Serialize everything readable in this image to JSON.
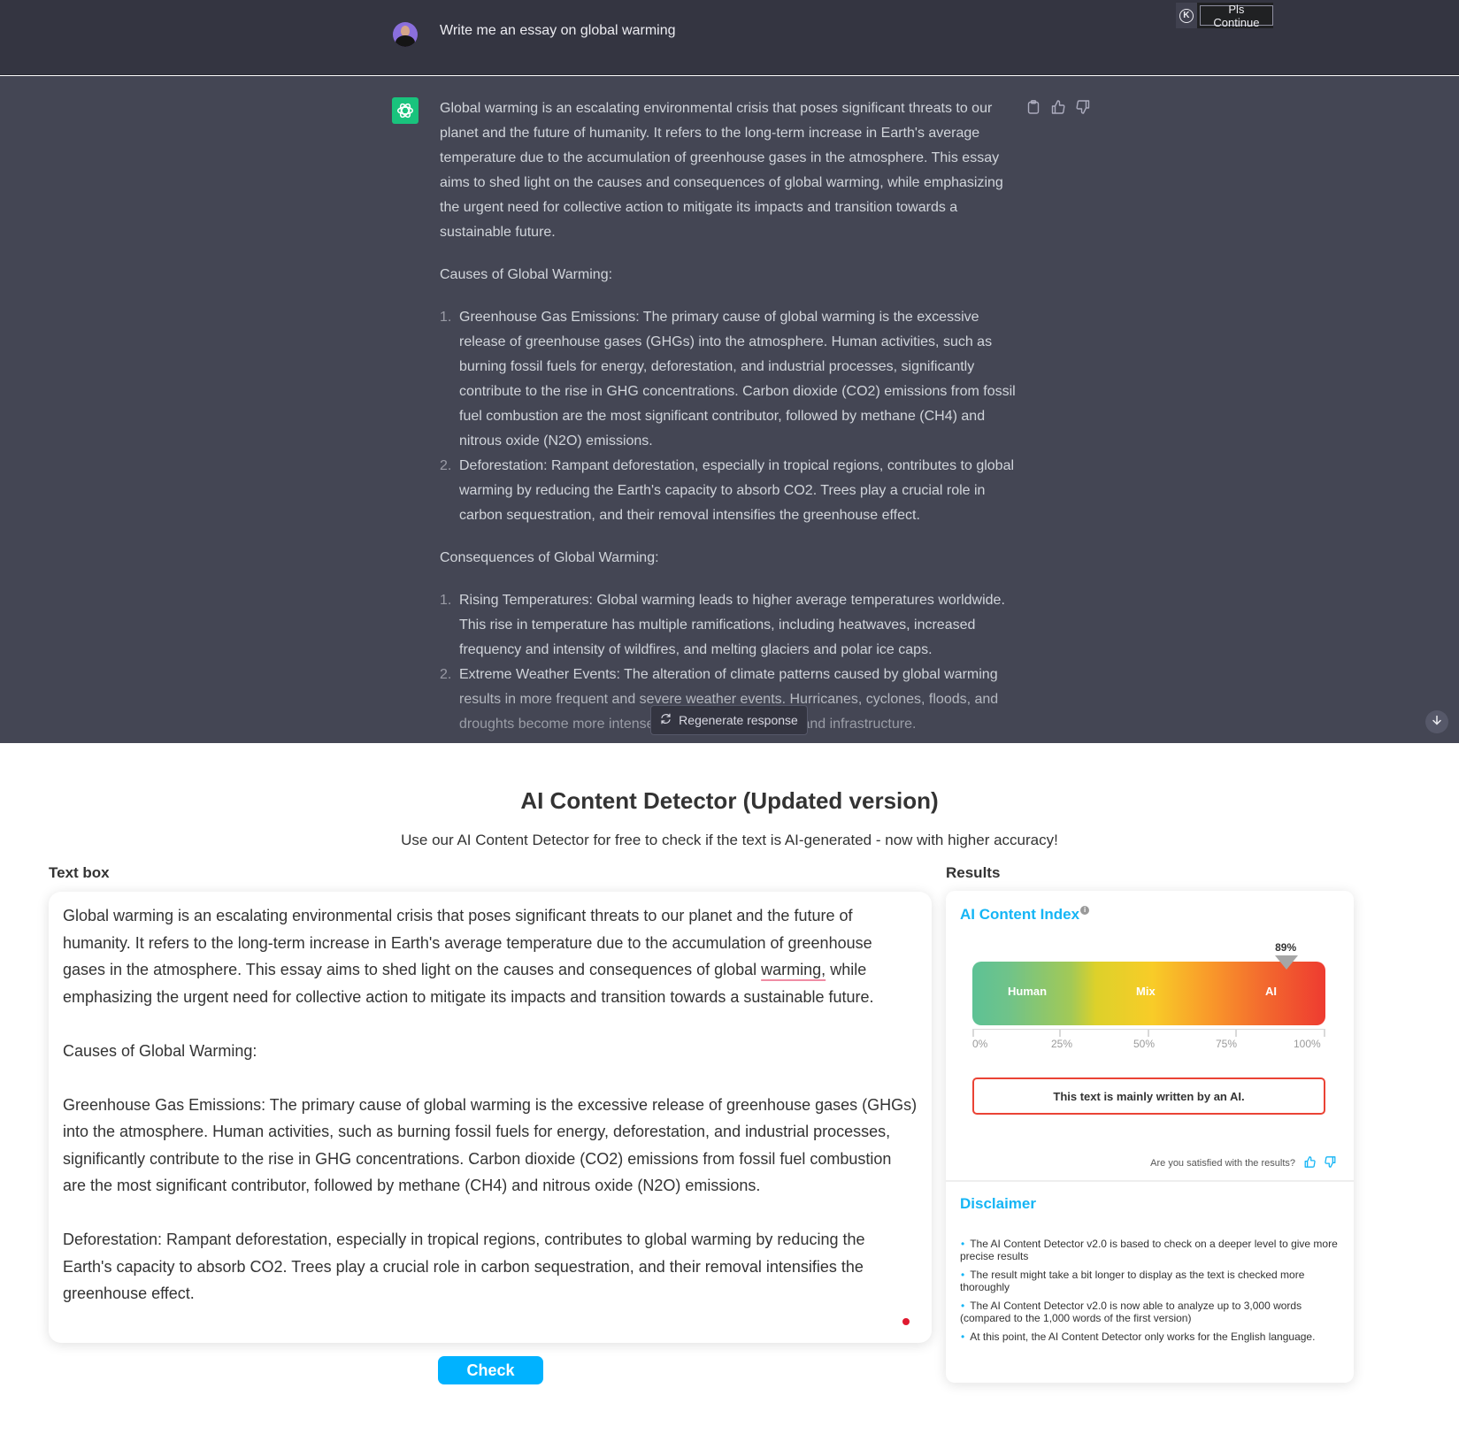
{
  "chat": {
    "prompt": "Write me an essay on global warming",
    "extension_button": "Pls Continue",
    "extension_icon": "K",
    "response": {
      "intro": "Global warming is an escalating environmental crisis that poses significant threats to our planet and the future of humanity. It refers to the long-term increase in Earth's average temperature due to the accumulation of greenhouse gases in the atmosphere. This essay aims to shed light on the causes and consequences of global warming, while emphasizing the urgent need for collective action to mitigate its impacts and transition towards a sustainable future.",
      "causes_heading": "Causes of Global Warming:",
      "causes": [
        {
          "num": "1.",
          "text": "Greenhouse Gas Emissions: The primary cause of global warming is the excessive release of greenhouse gases (GHGs) into the atmosphere. Human activities, such as burning fossil fuels for energy, deforestation, and industrial processes, significantly contribute to the rise in GHG concentrations. Carbon dioxide (CO2) emissions from fossil fuel combustion are the most significant contributor, followed by methane (CH4) and nitrous oxide (N2O) emissions."
        },
        {
          "num": "2.",
          "text": "Deforestation: Rampant deforestation, especially in tropical regions, contributes to global warming by reducing the Earth's capacity to absorb CO2. Trees play a crucial role in carbon sequestration, and their removal intensifies the greenhouse effect."
        }
      ],
      "consequences_heading": "Consequences of Global Warming:",
      "consequences": [
        {
          "num": "1.",
          "text": "Rising Temperatures: Global warming leads to higher average temperatures worldwide. This rise in temperature has multiple ramifications, including heatwaves, increased frequency and intensity of wildfires, and melting glaciers and polar ice caps."
        },
        {
          "num": "2.",
          "text": "Extreme Weather Events: The alteration of climate patterns caused by global warming results in more frequent and severe weather events. Hurricanes, cyclones, floods, and droughts become more intense, affecting ecosystems, and infrastructure."
        }
      ]
    },
    "actions": [
      "copy-icon",
      "thumbs-up-icon",
      "thumbs-down-icon"
    ],
    "regenerate_label": "Regenerate response"
  },
  "detector": {
    "title": "AI Content Detector (Updated version)",
    "subtitle": "Use our AI Content Detector for free to check if the text is AI-generated - now with higher accuracy!",
    "textbox_label": "Text box",
    "textbox": {
      "para1_before": "Global warming is an escalating environmental crisis that poses significant threats to our planet and the future of humanity. It refers to the long-term increase in Earth's average temperature due to the accumulation of greenhouse gases in the atmosphere. This essay aims to shed light on the causes and consequences of global ",
      "para1_flagged": "warming,",
      "para1_after": " while emphasizing the urgent need for collective action to mitigate its impacts and transition towards a sustainable future.",
      "rest": "\n\nCauses of Global Warming:\n\nGreenhouse Gas Emissions: The primary cause of global warming is the excessive release of greenhouse gases (GHGs) into the atmosphere. Human activities, such as burning fossil fuels for energy, deforestation, and industrial processes, significantly contribute to the rise in GHG concentrations. Carbon dioxide (CO2) emissions from fossil fuel combustion are the most significant contributor, followed by methane (CH4) and nitrous oxide (N2O) emissions.\n\nDeforestation: Rampant deforestation, especially in tropical regions, contributes to global warming by reducing the Earth's capacity to absorb CO2. Trees play a crucial role in carbon sequestration, and their removal intensifies the greenhouse effect."
    },
    "check_label": "Check",
    "results_label": "Results",
    "results": {
      "index_title": "AI Content Index",
      "info_icon": "i",
      "score_percent": 89,
      "score_label": "89%",
      "zones": [
        "Human",
        "Mix",
        "AI"
      ],
      "ticks": [
        "0%",
        "25%",
        "50%",
        "75%",
        "100%"
      ],
      "verdict": "This text is mainly written by an AI.",
      "satisfied_prompt": "Are you satisfied with the results?",
      "accent_color": "#15b5f5",
      "verdict_border_color": "#ea4335"
    },
    "disclaimer": {
      "title": "Disclaimer",
      "items": [
        "The AI Content Detector v2.0 is based to check on a deeper level to give more precise results",
        "The result might take a bit longer to display as the text is checked more thoroughly",
        "The AI Content Detector v2.0 is now able to analyze up to 3,000 words (compared to the 1,000 words of the first version)",
        "At this point, the AI Content Detector only works for the English language."
      ]
    }
  }
}
